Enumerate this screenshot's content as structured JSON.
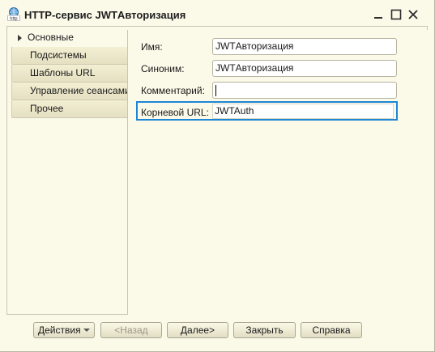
{
  "window": {
    "title": "HTTP-сервис JWTАвторизация",
    "icon_text": "http"
  },
  "nav": {
    "items": [
      {
        "label": "Основные",
        "active": true
      },
      {
        "label": "Подсистемы",
        "active": false
      },
      {
        "label": "Шаблоны URL",
        "active": false
      },
      {
        "label": "Управление сеансами",
        "active": false
      },
      {
        "label": "Прочее",
        "active": false
      }
    ]
  },
  "form": {
    "name_label": "Имя:",
    "name_value": "JWTАвторизация",
    "synonym_label": "Синоним:",
    "synonym_value": "JWTАвторизация",
    "comment_label": "Комментарий:",
    "comment_value": "",
    "root_url_label": "Корневой URL:",
    "root_url_value": "JWTAuth"
  },
  "buttons": {
    "actions": "Действия",
    "back": "<Назад",
    "next": "Далее>",
    "close": "Закрыть",
    "help": "Справка"
  },
  "colors": {
    "window_bg": "#fbf9e8",
    "focus": "#1e86d6"
  }
}
